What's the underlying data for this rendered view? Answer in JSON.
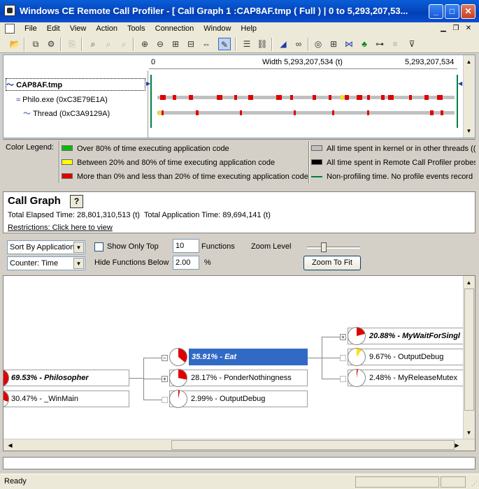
{
  "window": {
    "title": "Windows CE Remote Call Profiler - [ Call Graph  1 :CAP8AF.tmp ( Full ) | 0 to 5,293,207,53...",
    "minimize": "_",
    "maximize": "□",
    "close": "✕"
  },
  "menu": {
    "items": [
      "File",
      "Edit",
      "View",
      "Action",
      "Tools",
      "Connection",
      "Window",
      "Help"
    ]
  },
  "timeline": {
    "start": "0",
    "width_label": "Width 5,293,207,534 (t)",
    "end": "5,293,207,534",
    "tree": {
      "file": "CAP8AF.tmp",
      "process": "Philo.exe (0xC3E79E1A)",
      "thread": "Thread (0xC3A9129A)"
    }
  },
  "legend": {
    "title": "Color Legend:",
    "items": [
      {
        "color": "#00c000",
        "label": "Over 80% of time executing application code"
      },
      {
        "color": "#ffff00",
        "label": "Between 20% and 80% of time executing application code"
      },
      {
        "color": "#e00000",
        "label": "More than 0% and less than 20% of time executing application code"
      },
      {
        "color": "#c0c0c0",
        "label": "All time spent in kernel or in other threads (("
      },
      {
        "color": "#000000",
        "label": "All time spent in Remote Call Profiler probes"
      },
      {
        "color": "#008040",
        "label": "Non-profiling time.  No profile events record"
      }
    ]
  },
  "callgraph": {
    "title": "Call Graph",
    "help": "?",
    "total_elapsed": "Total Elapsed Time: 28,801,310,513 (t)",
    "total_app": "Total Application Time: 89,694,141 (t)",
    "restrictions": "Restrictions: Click here to view"
  },
  "controls": {
    "sort_by": "Sort By Application",
    "counter": "Counter: Time",
    "show_only_top": "Show Only Top",
    "top_n": "10",
    "functions": "Functions",
    "hide_below": "Hide Functions Below",
    "hide_value": "2.00",
    "percent": "%",
    "zoom_level": "Zoom Level",
    "zoom_to_fit": "Zoom To Fit",
    "zoom_fraction": 0.3
  },
  "nodes": {
    "philosopher": {
      "label": "69.53% - Philosopher",
      "pct": 69.53
    },
    "winmain": {
      "label": "30.47% - _WinMain",
      "pct": 30.47
    },
    "eat": {
      "label": "35.91% - Eat",
      "pct": 35.91
    },
    "ponder": {
      "label": "28.17% - PonderNothingness",
      "pct": 28.17
    },
    "outputdebug1": {
      "label": "2.99% - OutputDebug",
      "pct": 2.99
    },
    "mywait": {
      "label": "20.88% - MyWaitForSingl",
      "pct": 20.88
    },
    "outputdebug2": {
      "label": "9.67% - OutputDebug",
      "pct": 9.67
    },
    "myrelease": {
      "label": "2.48% - MyReleaseMutex",
      "pct": 2.48
    }
  },
  "status": {
    "text": "Ready"
  }
}
